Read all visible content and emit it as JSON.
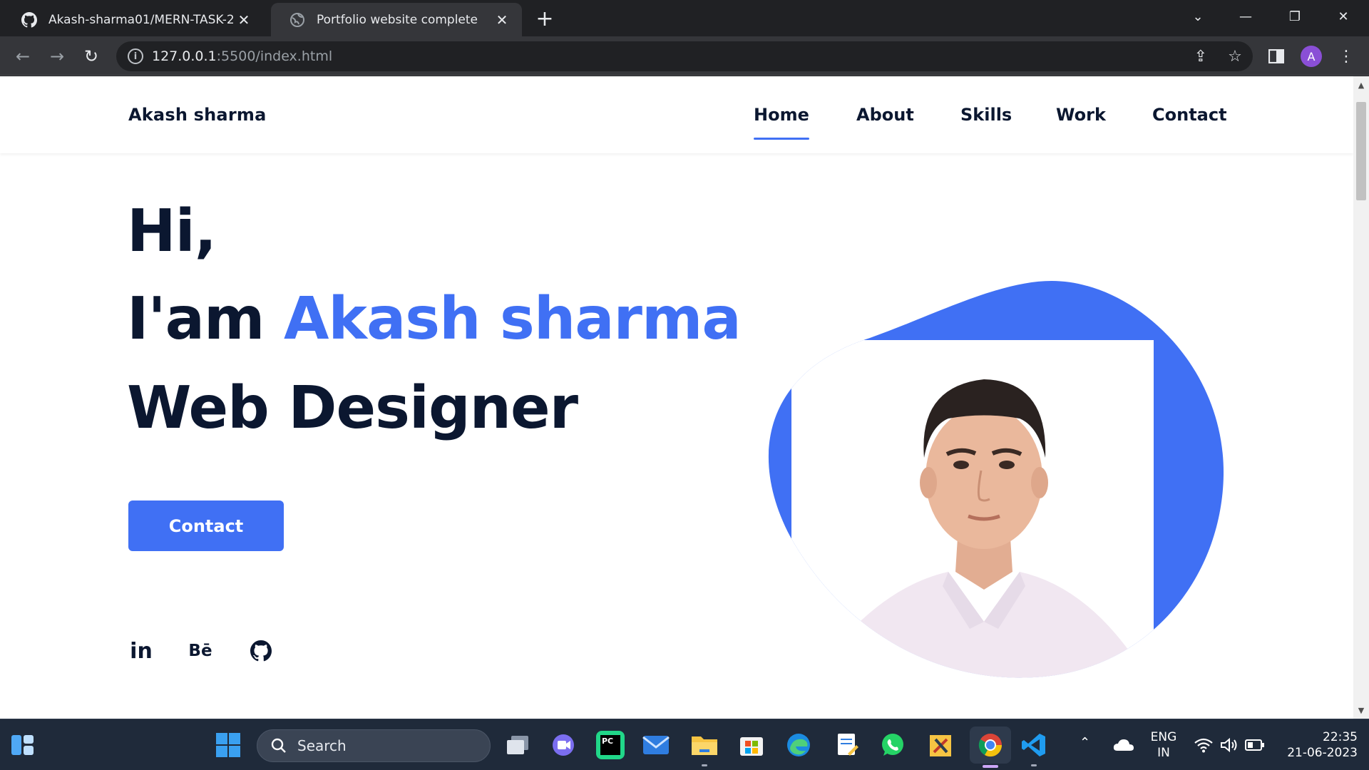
{
  "browser": {
    "tabs": [
      {
        "title": "Akash-sharma01/MERN-TASK-2",
        "icon": "github-icon",
        "active": false
      },
      {
        "title": "Portfolio website complete",
        "icon": "globe-icon",
        "active": true
      }
    ],
    "url_host": "127.0.0.1",
    "url_rest": ":5500/index.html",
    "profile_initial": "A"
  },
  "page": {
    "logo": "Akash sharma",
    "nav": [
      "Home",
      "About",
      "Skills",
      "Work",
      "Contact"
    ],
    "active_nav": "Home",
    "hero": {
      "line1": "Hi,",
      "line2_prefix": "I'am ",
      "name": "Akash sharma",
      "line3": "Web Designer"
    },
    "contact_button": "Contact",
    "social": [
      {
        "label": "in",
        "icon": "linkedin-icon"
      },
      {
        "label": "Bē",
        "icon": "behance-icon"
      },
      {
        "label": "",
        "icon": "github-icon"
      }
    ],
    "accent_color": "#4070f4",
    "text_color": "#0b1730"
  },
  "taskbar": {
    "search_label": "Search",
    "language_top": "ENG",
    "language_bottom": "IN",
    "time": "22:35",
    "date": "21-06-2023",
    "apps": [
      "widgets",
      "start",
      "task-view",
      "chat",
      "pycharm",
      "mail",
      "file-explorer",
      "microsoft-store",
      "edge",
      "notepad",
      "whatsapp",
      "tools",
      "chrome",
      "vscode"
    ]
  }
}
